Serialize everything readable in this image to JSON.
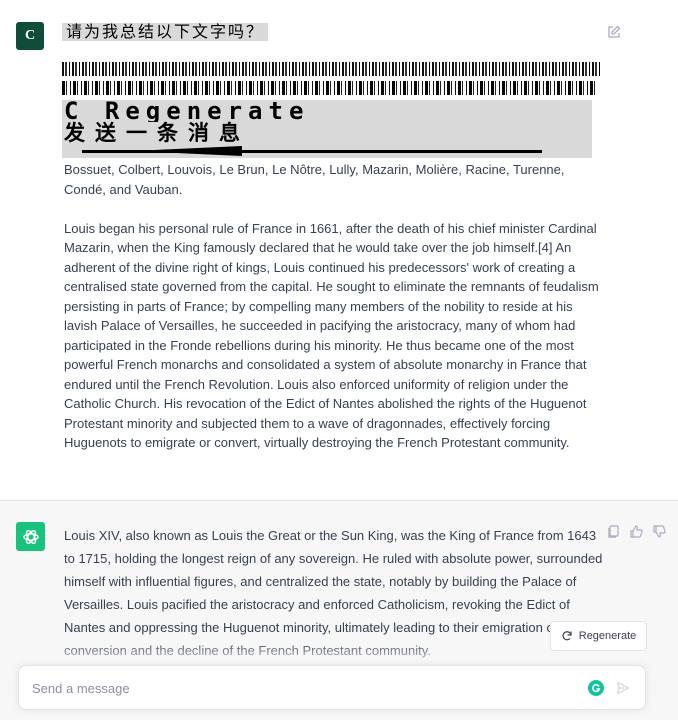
{
  "user_message": {
    "avatar_letter": "C",
    "title": "请为我总结以下文字吗？",
    "overlay_regenerate": "C Regenerate",
    "overlay_send": "发送一条消息",
    "paragraphs": [
      "Bossuet, Colbert, Louvois, Le Brun, Le Nôtre, Lully, Mazarin, Molière, Racine, Turenne, Condé, and Vauban.",
      "Louis began his personal rule of France in 1661, after the death of his chief minister Cardinal Mazarin, when the King famously declared that he would take over the job himself.[4] An adherent of the divine right of kings, Louis continued his predecessors' work of creating a centralised state governed from the capital. He sought to eliminate the remnants of feudalism persisting in parts of France; by compelling many members of the nobility to reside at his lavish Palace of Versailles, he succeeded in pacifying the aristocracy, many of whom had participated in the Fronde rebellions during his minority. He thus became one of the most powerful French monarchs and consolidated a system of absolute monarchy in France that endured until the French Revolution. Louis also enforced uniformity of religion under the Catholic Church. His revocation of the Edict of Nantes abolished the rights of the Huguenot Protestant minority and subjected them to a wave of dragonnades, effectively forcing Huguenots to emigrate or convert, virtually destroying the French Protestant community."
    ]
  },
  "assistant_message": {
    "text": "Louis XIV, also known as Louis the Great or the Sun King, was the King of France from 1643 to 1715, holding the longest reign of any sovereign. He ruled with absolute power, surrounded himself with influential figures, and centralized the state, notably by building the Palace of Versailles. Louis pacified the aristocracy and enforced Catholicism, revoking the Edict of Nantes and oppressing the Huguenot minority, ultimately leading to their emigration or conversion and the decline of the French Protestant community."
  },
  "regenerate_label": "Regenerate",
  "composer": {
    "placeholder": "Send a message"
  },
  "colors": {
    "user_avatar": "#0f4c3a",
    "assistant_avatar": "#19c37d",
    "assistant_bg": "#f7f7f8"
  },
  "icons": [
    "edit-icon",
    "copy-icon",
    "thumbs-up-icon",
    "thumbs-down-icon",
    "refresh-icon",
    "grammarly-icon",
    "send-icon"
  ]
}
